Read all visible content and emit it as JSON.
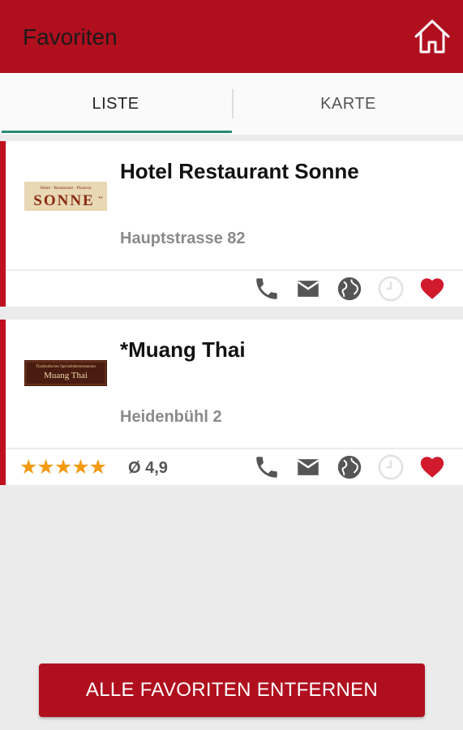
{
  "app_bar": {
    "title": "Favoriten",
    "home_icon": "home-icon"
  },
  "tabs": [
    {
      "label": "LISTE",
      "active": true
    },
    {
      "label": "KARTE",
      "active": false
    }
  ],
  "favorites": [
    {
      "name": "Hotel Restaurant Sonne",
      "address": "Hauptstrasse 82",
      "logo": {
        "top_text": "Hotel · Restaurant · Pizzeria",
        "main_text": "SONNE"
      },
      "rating": null
    },
    {
      "name": "*Muang Thai",
      "address": "Heidenbühl 2",
      "logo": {
        "top_text": "Thailändisches Spezialitätenrestaurant",
        "main_text": "Muang Thai"
      },
      "rating": {
        "stars": "★★★★★",
        "value": "Ø 4,9"
      }
    }
  ],
  "action_icons": [
    "phone-icon",
    "mail-icon",
    "globe-icon",
    "clock-icon",
    "heart-icon"
  ],
  "colors": {
    "brand_red": "#b00f1e",
    "accent_red": "#c0101f",
    "tab_indicator": "#2a8a74",
    "star": "#f39a10",
    "icon_gray": "#555555"
  },
  "footer": {
    "remove_all_label": "ALLE FAVORITEN ENTFERNEN"
  }
}
